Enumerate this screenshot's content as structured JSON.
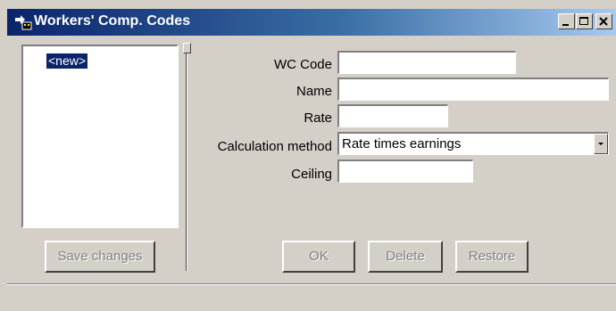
{
  "window": {
    "title": "Workers' Comp. Codes",
    "minimize_label": "_",
    "maximize_label": "□",
    "close_label": "×"
  },
  "list": {
    "items": [
      "<new>"
    ]
  },
  "form": {
    "wc_code": {
      "label": "WC Code",
      "value": ""
    },
    "name": {
      "label": "Name",
      "value": ""
    },
    "rate": {
      "label": "Rate",
      "value": ""
    },
    "calculation_method": {
      "label": "Calculation method",
      "value": "Rate times earnings"
    },
    "ceiling": {
      "label": "Ceiling",
      "value": ""
    }
  },
  "buttons": {
    "save_changes": "Save changes",
    "ok": "OK",
    "delete": "Delete",
    "restore": "Restore"
  }
}
